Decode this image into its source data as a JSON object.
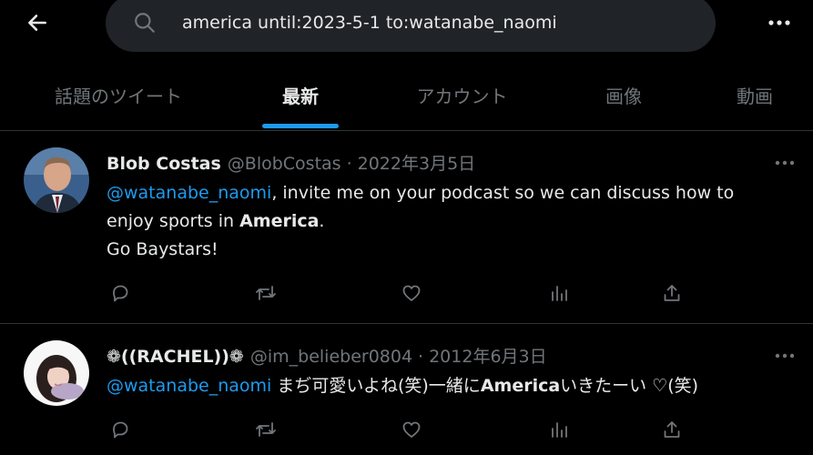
{
  "search": {
    "query": "america until:2023-5-1 to:watanabe_naomi"
  },
  "tabs": [
    {
      "label": "話題のツイート",
      "active": false
    },
    {
      "label": "最新",
      "active": true
    },
    {
      "label": "アカウント",
      "active": false
    },
    {
      "label": "画像",
      "active": false
    },
    {
      "label": "動画",
      "active": false
    }
  ],
  "colors": {
    "background": "#000000",
    "accent": "#1d9bf0",
    "muted": "#71767b",
    "text": "#e7e9ea",
    "search_bg": "#202327",
    "divider": "#2f3336"
  },
  "icons": {
    "back": "arrow-left-icon",
    "search": "search-icon",
    "more": "more-icon",
    "reply": "reply-icon",
    "retweet": "retweet-icon",
    "like": "like-icon",
    "views": "views-icon",
    "share": "share-icon"
  },
  "tweets": [
    {
      "name": "Blob Costas",
      "handle": "@BlobCostas",
      "separator": "·",
      "date": "2022年3月5日",
      "mention": "@watanabe_naomi",
      "line1_rest": ", invite me on your podcast so we can discuss how to",
      "line2_pre": "enjoy sports in ",
      "line2_bold": "America",
      "line2_post": ".",
      "line3": "Go Baystars!"
    },
    {
      "name": "❁((RACHEL))❁",
      "handle": "@im_belieber0804",
      "separator": "·",
      "date": "2012年6月3日",
      "mention": "@watanabe_naomi",
      "text_pre": " まぢ可愛いよね(笑)一緒に",
      "text_bold": "America",
      "text_post": "いきたーい ♡(笑)"
    }
  ]
}
